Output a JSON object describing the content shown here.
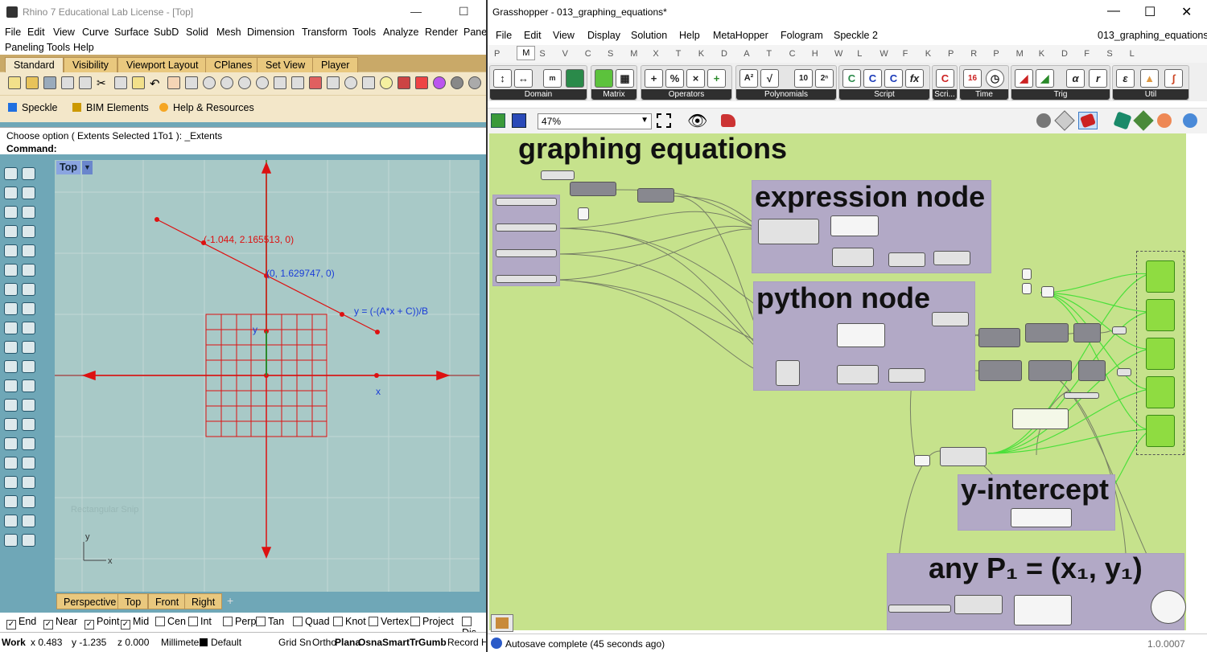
{
  "rhino": {
    "title": "Rhino 7 Educational Lab License - [Top]",
    "menu": [
      "File",
      "Edit",
      "View",
      "Curve",
      "Surface",
      "SubD",
      "Solid",
      "Mesh",
      "Dimension",
      "Transform",
      "Tools",
      "Analyze",
      "Render",
      "Pane"
    ],
    "menu2": [
      "Paneling Tools",
      "Help"
    ],
    "tabs": [
      "Standard",
      "Visibility",
      "Viewport Layout",
      "CPlanes",
      "Set View",
      "Player"
    ],
    "plugins": [
      "Speckle",
      "BIM Elements",
      "Help & Resources"
    ],
    "command_history": "Choose option ( Extents  Selected  1To1 ): _Extents",
    "command_label": "Command:",
    "viewport": {
      "name": "Top",
      "pt1_label": "(-1.044, 2.165513, 0)",
      "pt2_label": "(0, 1.629747, 0)",
      "equation": "y = (-(A*x + C))/B",
      "axis_x": "x",
      "axis_y": "y",
      "ghost_text": "Rectangular Snip",
      "gizmo_x": "x",
      "gizmo_y": "y"
    },
    "view_tabs": [
      "Perspective",
      "Top",
      "Front",
      "Right"
    ],
    "snaps": [
      {
        "label": "End",
        "checked": true
      },
      {
        "label": "Near",
        "checked": true
      },
      {
        "label": "Point",
        "checked": true
      },
      {
        "label": "Mid",
        "checked": true
      },
      {
        "label": "Cen",
        "checked": false
      },
      {
        "label": "Int",
        "checked": false
      },
      {
        "label": "Perp",
        "checked": false
      },
      {
        "label": "Tan",
        "checked": false
      },
      {
        "label": "Quad",
        "checked": false
      },
      {
        "label": "Knot",
        "checked": false
      },
      {
        "label": "Vertex",
        "checked": false
      },
      {
        "label": "Project",
        "checked": false
      },
      {
        "label": "Dis",
        "checked": false
      }
    ],
    "status": {
      "cplane": "Work",
      "x": "x 0.483",
      "y": "y -1.235",
      "z": "z 0.000",
      "units": "Millimeter",
      "layer": "Default",
      "grid": "Grid Sn",
      "ortho": "Ortho",
      "planar": "Plana",
      "osnap": "Osna",
      "smart": "SmartTr",
      "gumball": "Gumb",
      "record": "Record H"
    }
  },
  "gh": {
    "title": "Grasshopper - 013_graphing_equations*",
    "doc_name": "013_graphing_equations",
    "menu": [
      "File",
      "Edit",
      "View",
      "Display",
      "Solution",
      "Help",
      "MetaHopper",
      "Fologram",
      "Speckle 2"
    ],
    "cat_tabs": [
      "P",
      "M",
      "S",
      "V",
      "C",
      "S",
      "M",
      "X",
      "T",
      "K",
      "D",
      "A",
      "T",
      "C",
      "H",
      "W",
      "L",
      "W",
      "F",
      "K",
      "P",
      "R",
      "P",
      "M",
      "K",
      "D",
      "F",
      "S",
      "L"
    ],
    "ribbon_groups": [
      "Domain",
      "Matrix",
      "Operators",
      "Polynomials",
      "Script",
      "Scri...",
      "Time",
      "Trig",
      "Util"
    ],
    "zoom": "47%",
    "groups": {
      "main": "graphing equations",
      "expr": "expression node",
      "python": "python node",
      "yint": "y-intercept",
      "any": "any P₁ = (x₁, y₁)"
    },
    "status": "Autosave complete (45 seconds ago)",
    "version": "1.0.0007",
    "accent_green": "#8fdc41",
    "canvas_color": "#c6e28c",
    "group_color": "#b2a9c6"
  }
}
